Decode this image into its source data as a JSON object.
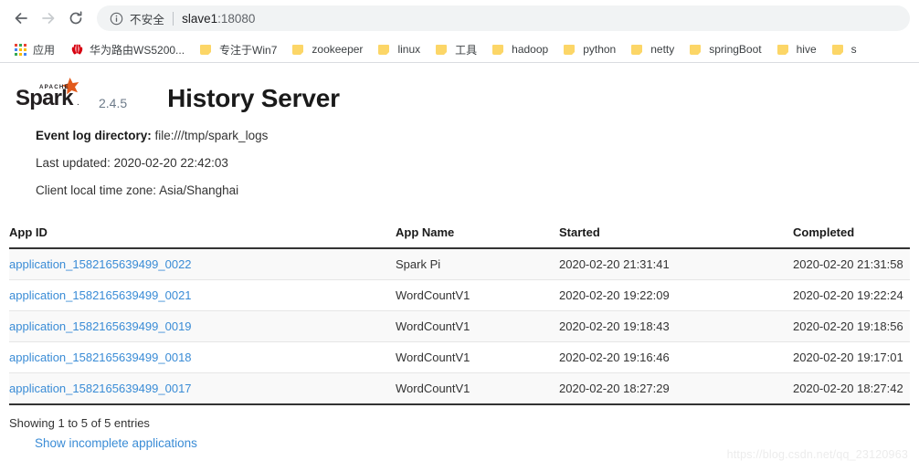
{
  "browser": {
    "nav": {
      "back_title": "Back",
      "forward_title": "Forward",
      "reload_title": "Reload"
    },
    "omnibox": {
      "security_label": "不安全",
      "url_host": "slave1",
      "url_port": ":18080"
    },
    "bookmarks": [
      {
        "label": "应用",
        "icon": "apps-grid-icon"
      },
      {
        "label": "华为路由WS5200...",
        "icon": "huawei-icon"
      },
      {
        "label": "专注于Win7",
        "icon": "folder-icon"
      },
      {
        "label": "zookeeper",
        "icon": "folder-icon"
      },
      {
        "label": "linux",
        "icon": "folder-icon"
      },
      {
        "label": "工具",
        "icon": "folder-icon"
      },
      {
        "label": "hadoop",
        "icon": "folder-icon"
      },
      {
        "label": "python",
        "icon": "folder-icon"
      },
      {
        "label": "netty",
        "icon": "folder-icon"
      },
      {
        "label": "springBoot",
        "icon": "folder-icon"
      },
      {
        "label": "hive",
        "icon": "folder-icon"
      },
      {
        "label": "s",
        "icon": "folder-icon"
      }
    ]
  },
  "app": {
    "logo_text": "Spark",
    "logo_supertext": "APACHE",
    "version": "2.4.5",
    "title": "History Server",
    "info": {
      "event_log_label": "Event log directory:",
      "event_log_value": " file:///tmp/spark_logs",
      "last_updated": "Last updated: 2020-02-20 22:42:03",
      "time_zone": "Client local time zone: Asia/Shanghai"
    },
    "table": {
      "headers": [
        "App ID",
        "App Name",
        "Started",
        "Completed"
      ],
      "rows": [
        {
          "app_id": "application_1582165639499_0022",
          "app_name": "Spark Pi",
          "started": "2020-02-20 21:31:41",
          "completed": "2020-02-20 21:31:58"
        },
        {
          "app_id": "application_1582165639499_0021",
          "app_name": "WordCountV1",
          "started": "2020-02-20 19:22:09",
          "completed": "2020-02-20 19:22:24"
        },
        {
          "app_id": "application_1582165639499_0019",
          "app_name": "WordCountV1",
          "started": "2020-02-20 19:18:43",
          "completed": "2020-02-20 19:18:56"
        },
        {
          "app_id": "application_1582165639499_0018",
          "app_name": "WordCountV1",
          "started": "2020-02-20 19:16:46",
          "completed": "2020-02-20 19:17:01"
        },
        {
          "app_id": "application_1582165639499_0017",
          "app_name": "WordCountV1",
          "started": "2020-02-20 18:27:29",
          "completed": "2020-02-20 18:27:42"
        }
      ]
    },
    "footer": {
      "showing": "Showing 1 to 5 of 5 entries",
      "incomplete_link": "Show incomplete applications"
    },
    "watermark": "https://blog.csdn.net/qq_23120963"
  },
  "colors": {
    "link": "#3a8cd6",
    "spark_orange": "#e25a1c",
    "version_gray": "#6c7a89",
    "folder_yellow": "#fcd667"
  }
}
